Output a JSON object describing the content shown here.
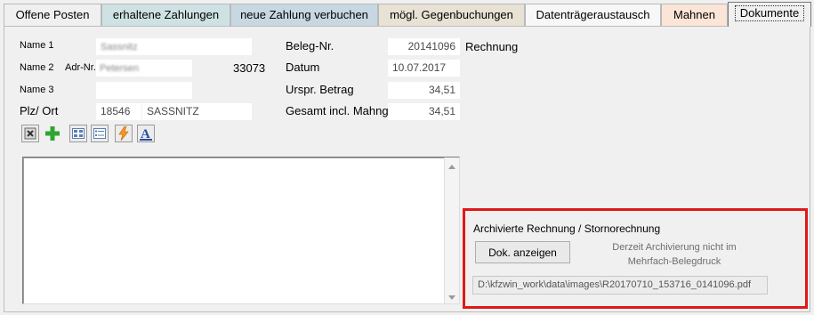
{
  "tabs": [
    {
      "label": "Offene Posten",
      "bg": "#f0f0f0"
    },
    {
      "label": "erhaltene Zahlungen",
      "bg": "#cfe2e3"
    },
    {
      "label": "neue Zahlung verbuchen",
      "bg": "#c7d8e2"
    },
    {
      "label": "mögl. Gegenbuchungen",
      "bg": "#e7e2d4"
    },
    {
      "label": "Datenträgeraustausch",
      "bg": "#f7f7f7"
    },
    {
      "label": "Mahnen",
      "bg": "#fbe5d6"
    },
    {
      "label": "Dokumente",
      "bg": "#f0f0f0"
    }
  ],
  "address": {
    "name1_label": "Name 1",
    "name1_value": "Sassnitz",
    "name2_label": "Name 2",
    "adr_label": "Adr-Nr.",
    "adr_value": "Petersen",
    "adr_number": "33073",
    "name3_label": "Name 3",
    "name3_value": "",
    "plz_label": "Plz/ Ort",
    "plz_value": "18546",
    "ort_value": "SASSNITZ"
  },
  "beleg": {
    "nr_label": "Beleg-Nr.",
    "nr_value": "20141096",
    "type_text": "Rechnung",
    "datum_label": "Datum",
    "datum_value": "10.07.2017",
    "betrag_label": "Urspr. Betrag",
    "betrag_value": "34,51",
    "gesamt_label": "Gesamt incl. Mahng.",
    "gesamt_value": "34,51"
  },
  "toolbar_icons": [
    "delete-icon",
    "add-icon",
    "grid-view-icon",
    "list-view-icon",
    "lightning-icon",
    "font-icon"
  ],
  "archive": {
    "title": "Archivierte Rechnung / Stornorechnung",
    "button_label": "Dok. anzeigen",
    "note": "Derzeit Archivierung nicht im Mehrfach-Belegdruck",
    "path": "D:\\kfzwin_work\\data\\images\\R20170710_153716_0141096.pdf",
    "border_color": "#e01818"
  }
}
